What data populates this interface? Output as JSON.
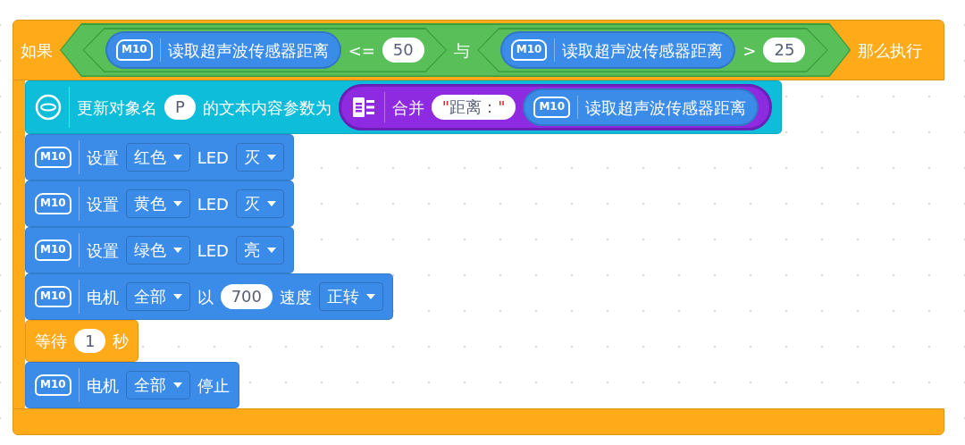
{
  "if_block": {
    "label_if": "如果",
    "label_then": "那么执行",
    "condition": {
      "parts": [
        {
          "kind": "compare",
          "parts": [
            {
              "kind": "m10_reporter",
              "icon_label": "M10",
              "parts": [
                {
                  "kind": "text",
                  "text": "读取超声波传感器距离"
                }
              ]
            },
            {
              "kind": "text",
              "text": "<="
            },
            {
              "kind": "number",
              "value": "50"
            }
          ]
        },
        {
          "kind": "text",
          "text": "与"
        },
        {
          "kind": "compare",
          "parts": [
            {
              "kind": "m10_reporter",
              "icon_label": "M10",
              "parts": [
                {
                  "kind": "text",
                  "text": "读取超声波传感器距离"
                }
              ]
            },
            {
              "kind": "text",
              "text": ">"
            },
            {
              "kind": "number",
              "value": "25"
            }
          ]
        }
      ]
    },
    "body": [
      {
        "kind": "sensor",
        "parts": [
          {
            "kind": "text",
            "text": "更新对象名"
          },
          {
            "kind": "number",
            "value": "P"
          },
          {
            "kind": "text",
            "text": "的文本内容参数为"
          },
          {
            "kind": "join_reporter",
            "parts": [
              {
                "kind": "text",
                "text": "合并"
              },
              {
                "kind": "string",
                "quote": "\"",
                "value": "距离："
              },
              {
                "kind": "m10_reporter",
                "icon_label": "M10",
                "parts": [
                  {
                    "kind": "text",
                    "text": "读取超声波传感器距离"
                  }
                ]
              }
            ]
          }
        ]
      },
      {
        "kind": "m10",
        "icon_label": "M10",
        "parts": [
          {
            "kind": "text",
            "text": "设置"
          },
          {
            "kind": "dropdown",
            "value": "红色"
          },
          {
            "kind": "text",
            "text": "LED"
          },
          {
            "kind": "dropdown",
            "value": "灭"
          }
        ]
      },
      {
        "kind": "m10",
        "icon_label": "M10",
        "parts": [
          {
            "kind": "text",
            "text": "设置"
          },
          {
            "kind": "dropdown",
            "value": "黄色"
          },
          {
            "kind": "text",
            "text": "LED"
          },
          {
            "kind": "dropdown",
            "value": "灭"
          }
        ]
      },
      {
        "kind": "m10",
        "icon_label": "M10",
        "parts": [
          {
            "kind": "text",
            "text": "设置"
          },
          {
            "kind": "dropdown",
            "value": "绿色"
          },
          {
            "kind": "text",
            "text": "LED"
          },
          {
            "kind": "dropdown",
            "value": "亮"
          }
        ]
      },
      {
        "kind": "m10",
        "icon_label": "M10",
        "parts": [
          {
            "kind": "text",
            "text": "电机"
          },
          {
            "kind": "dropdown",
            "value": "全部"
          },
          {
            "kind": "text",
            "text": "以"
          },
          {
            "kind": "number",
            "value": "700"
          },
          {
            "kind": "text",
            "text": "速度"
          },
          {
            "kind": "dropdown",
            "value": "正转"
          }
        ]
      },
      {
        "kind": "control",
        "parts": [
          {
            "kind": "text",
            "text": "等待"
          },
          {
            "kind": "number",
            "value": "1"
          },
          {
            "kind": "text",
            "text": "秒"
          }
        ]
      },
      {
        "kind": "m10",
        "icon_label": "M10",
        "parts": [
          {
            "kind": "text",
            "text": "电机"
          },
          {
            "kind": "dropdown",
            "value": "全部"
          },
          {
            "kind": "text",
            "text": "停止"
          }
        ]
      }
    ]
  }
}
